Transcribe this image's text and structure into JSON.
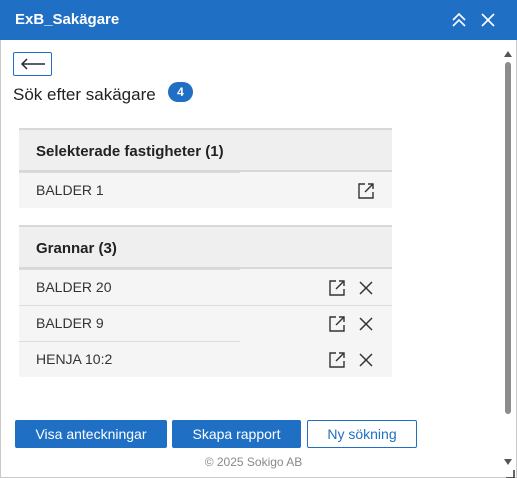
{
  "window": {
    "title": "ExB_Sakägare"
  },
  "header": {
    "title": "Sök efter sakägare",
    "count": "4"
  },
  "selected_section": {
    "title": "Selekterade fastigheter (1)",
    "rows": [
      {
        "label": "BALDER 1"
      }
    ]
  },
  "neighbors_section": {
    "title": "Grannar (3)",
    "rows": [
      {
        "label": "BALDER 20"
      },
      {
        "label": "BALDER 9"
      },
      {
        "label": "HENJA 10:2"
      }
    ]
  },
  "actions": {
    "show_notes": "Visa anteckningar",
    "create_report": "Skapa rapport",
    "new_search": "Ny sökning"
  },
  "footer": {
    "copyright": "© 2025 Sokigo AB"
  },
  "colors": {
    "accent": "#1f6fc4",
    "section_bg": "#efefef",
    "row_bg": "#f5f5f5"
  },
  "icons": [
    "chevron-double-up-icon",
    "close-icon",
    "arrow-left-icon",
    "open-external-icon",
    "remove-icon"
  ]
}
